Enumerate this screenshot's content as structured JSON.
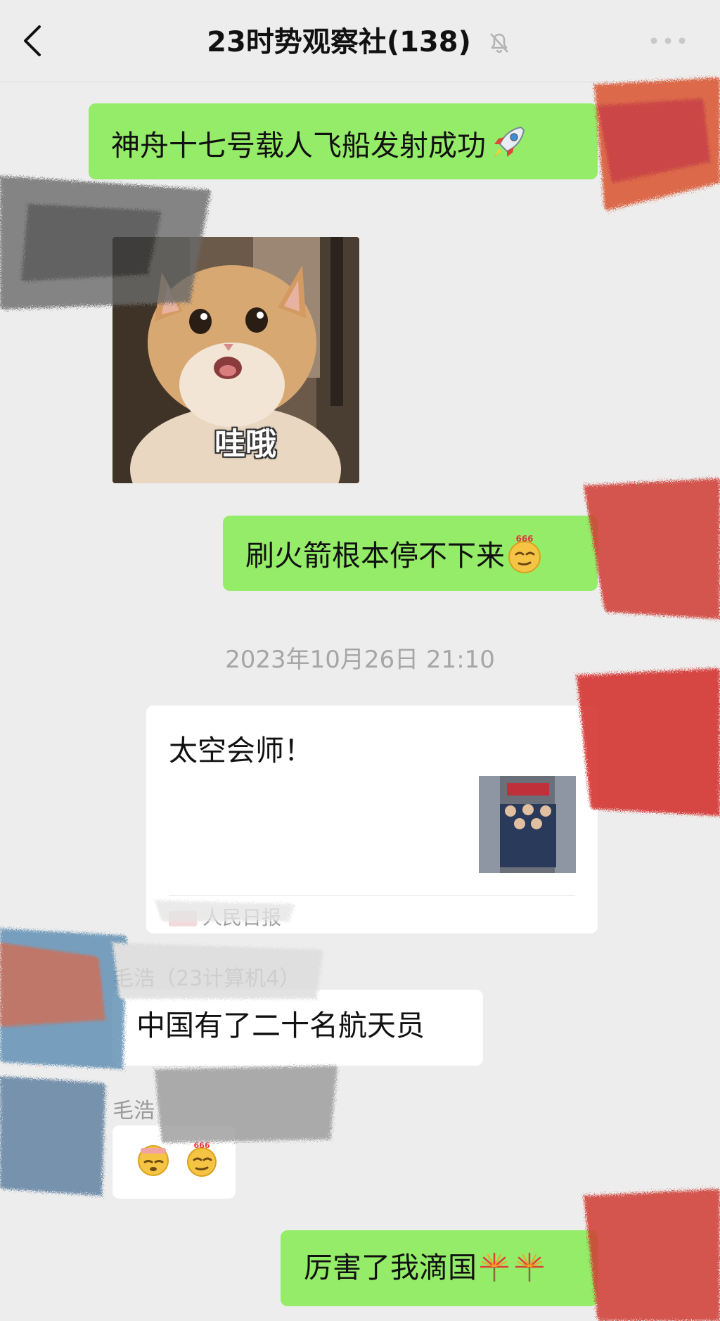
{
  "header": {
    "title": "23时势观察社(138)",
    "back_icon": "chevron-left-icon",
    "mute_icon": "bell-off-icon",
    "more_icon": "more-dots-icon"
  },
  "messages": [
    {
      "type": "text",
      "side": "right",
      "text": "神舟十七号载人飞船发射成功",
      "emoji": "rocket"
    },
    {
      "type": "sticker",
      "side": "left",
      "caption": "哇哦"
    },
    {
      "type": "text",
      "side": "right",
      "text": "刷火箭根本停不下来",
      "emoji": "666-face"
    },
    {
      "type": "timestamp",
      "text": "2023年10月26日 21:10"
    },
    {
      "type": "link_card",
      "side": "left",
      "title": "太空会师！",
      "source": "人民日报"
    },
    {
      "type": "text",
      "side": "left",
      "sender": "毛浩（23计算机4）",
      "text": "中国有了二十名航天员"
    },
    {
      "type": "emoji",
      "side": "left",
      "sender": "毛浩",
      "emojis": [
        "salute-face",
        "666-face"
      ]
    },
    {
      "type": "text",
      "side": "right",
      "text": "厉害了我滴国",
      "emoji": "fireworks"
    }
  ],
  "colors": {
    "background": "#ededed",
    "outgoing_bubble": "#95ec69",
    "incoming_bubble": "#ffffff",
    "meta_text": "#a6a6a6"
  }
}
